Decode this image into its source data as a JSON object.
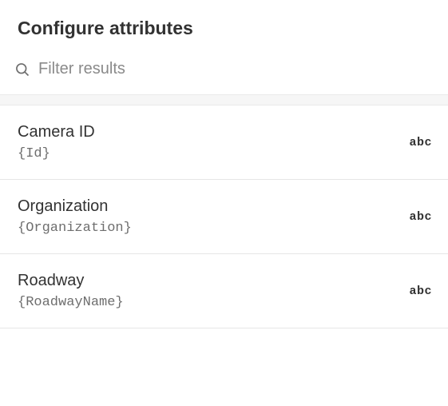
{
  "header": {
    "title": "Configure attributes"
  },
  "filter": {
    "placeholder": "Filter results",
    "value": "",
    "icon": "search-icon"
  },
  "attributes": [
    {
      "label": "Camera ID",
      "expression": "{Id}",
      "type_label": "abc"
    },
    {
      "label": "Organization",
      "expression": "{Organization}",
      "type_label": "abc"
    },
    {
      "label": "Roadway",
      "expression": "{RoadwayName}",
      "type_label": "abc"
    }
  ]
}
